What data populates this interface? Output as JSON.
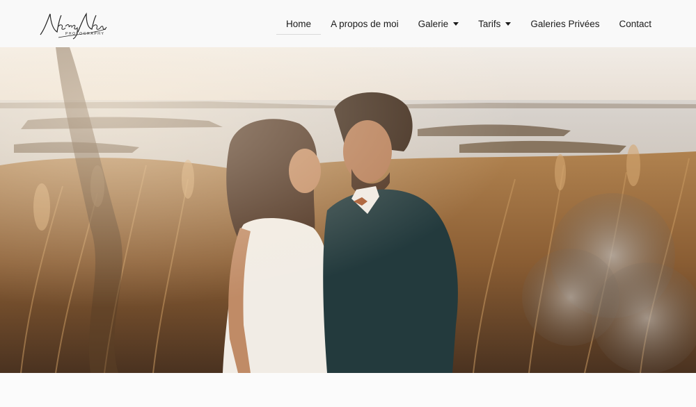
{
  "brand": {
    "logo_script": "NancyNau",
    "logo_sub": "PHOTOGRAPHY"
  },
  "nav": {
    "items": [
      {
        "label": "Home",
        "active": true,
        "dropdown": false
      },
      {
        "label": "A propos de moi",
        "active": false,
        "dropdown": false
      },
      {
        "label": "Galerie",
        "active": false,
        "dropdown": true
      },
      {
        "label": "Tarifs",
        "active": false,
        "dropdown": true
      },
      {
        "label": "Galeries Privées",
        "active": false,
        "dropdown": false
      },
      {
        "label": "Contact",
        "active": false,
        "dropdown": false
      }
    ]
  },
  "hero": {
    "slide_count": 3,
    "active_slide": 1
  },
  "colors": {
    "header_bg": "#f9f9f9",
    "text": "#1a1a1a"
  }
}
